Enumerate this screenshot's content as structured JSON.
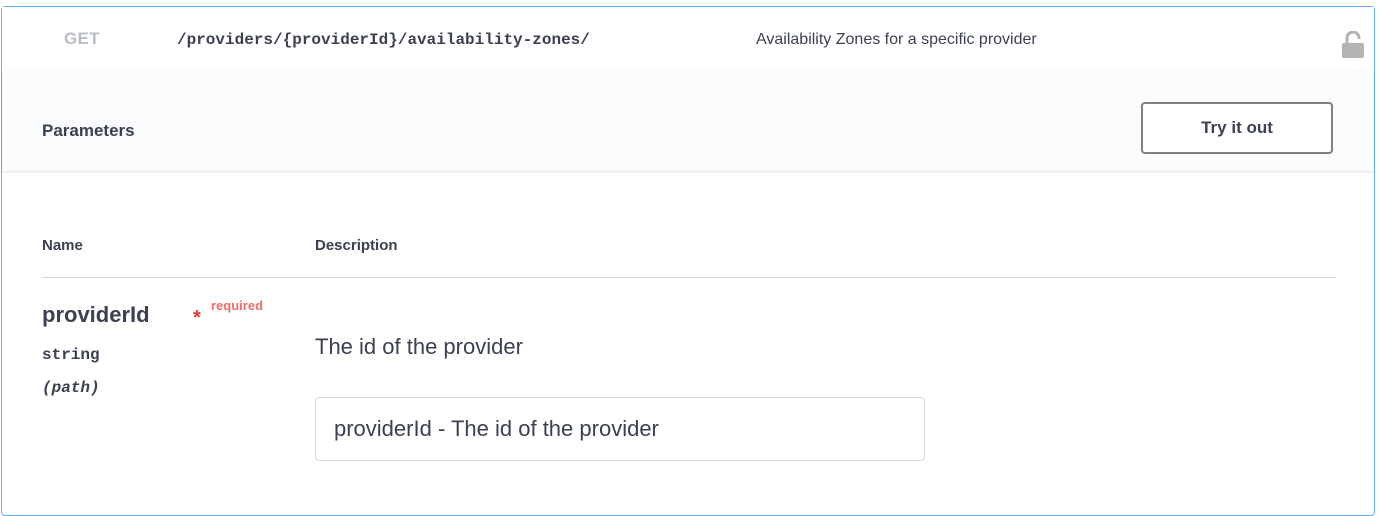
{
  "operation": {
    "method": "GET",
    "path": "/providers/{providerId}/availability-zones/",
    "summary": "Availability Zones for a specific provider",
    "icon": "unlocked-lock-icon",
    "accent_color": "#61affe"
  },
  "parameters_section": {
    "title": "Parameters",
    "try_button_label": "Try it out"
  },
  "table": {
    "columns": [
      "Name",
      "Description"
    ]
  },
  "parameter": {
    "name": "providerId",
    "required_marker": "*",
    "required_label": "required",
    "type": "string",
    "location": "(path)",
    "description": "The id of the provider",
    "input_placeholder": "providerId - The id of the provider",
    "input_value": ""
  }
}
